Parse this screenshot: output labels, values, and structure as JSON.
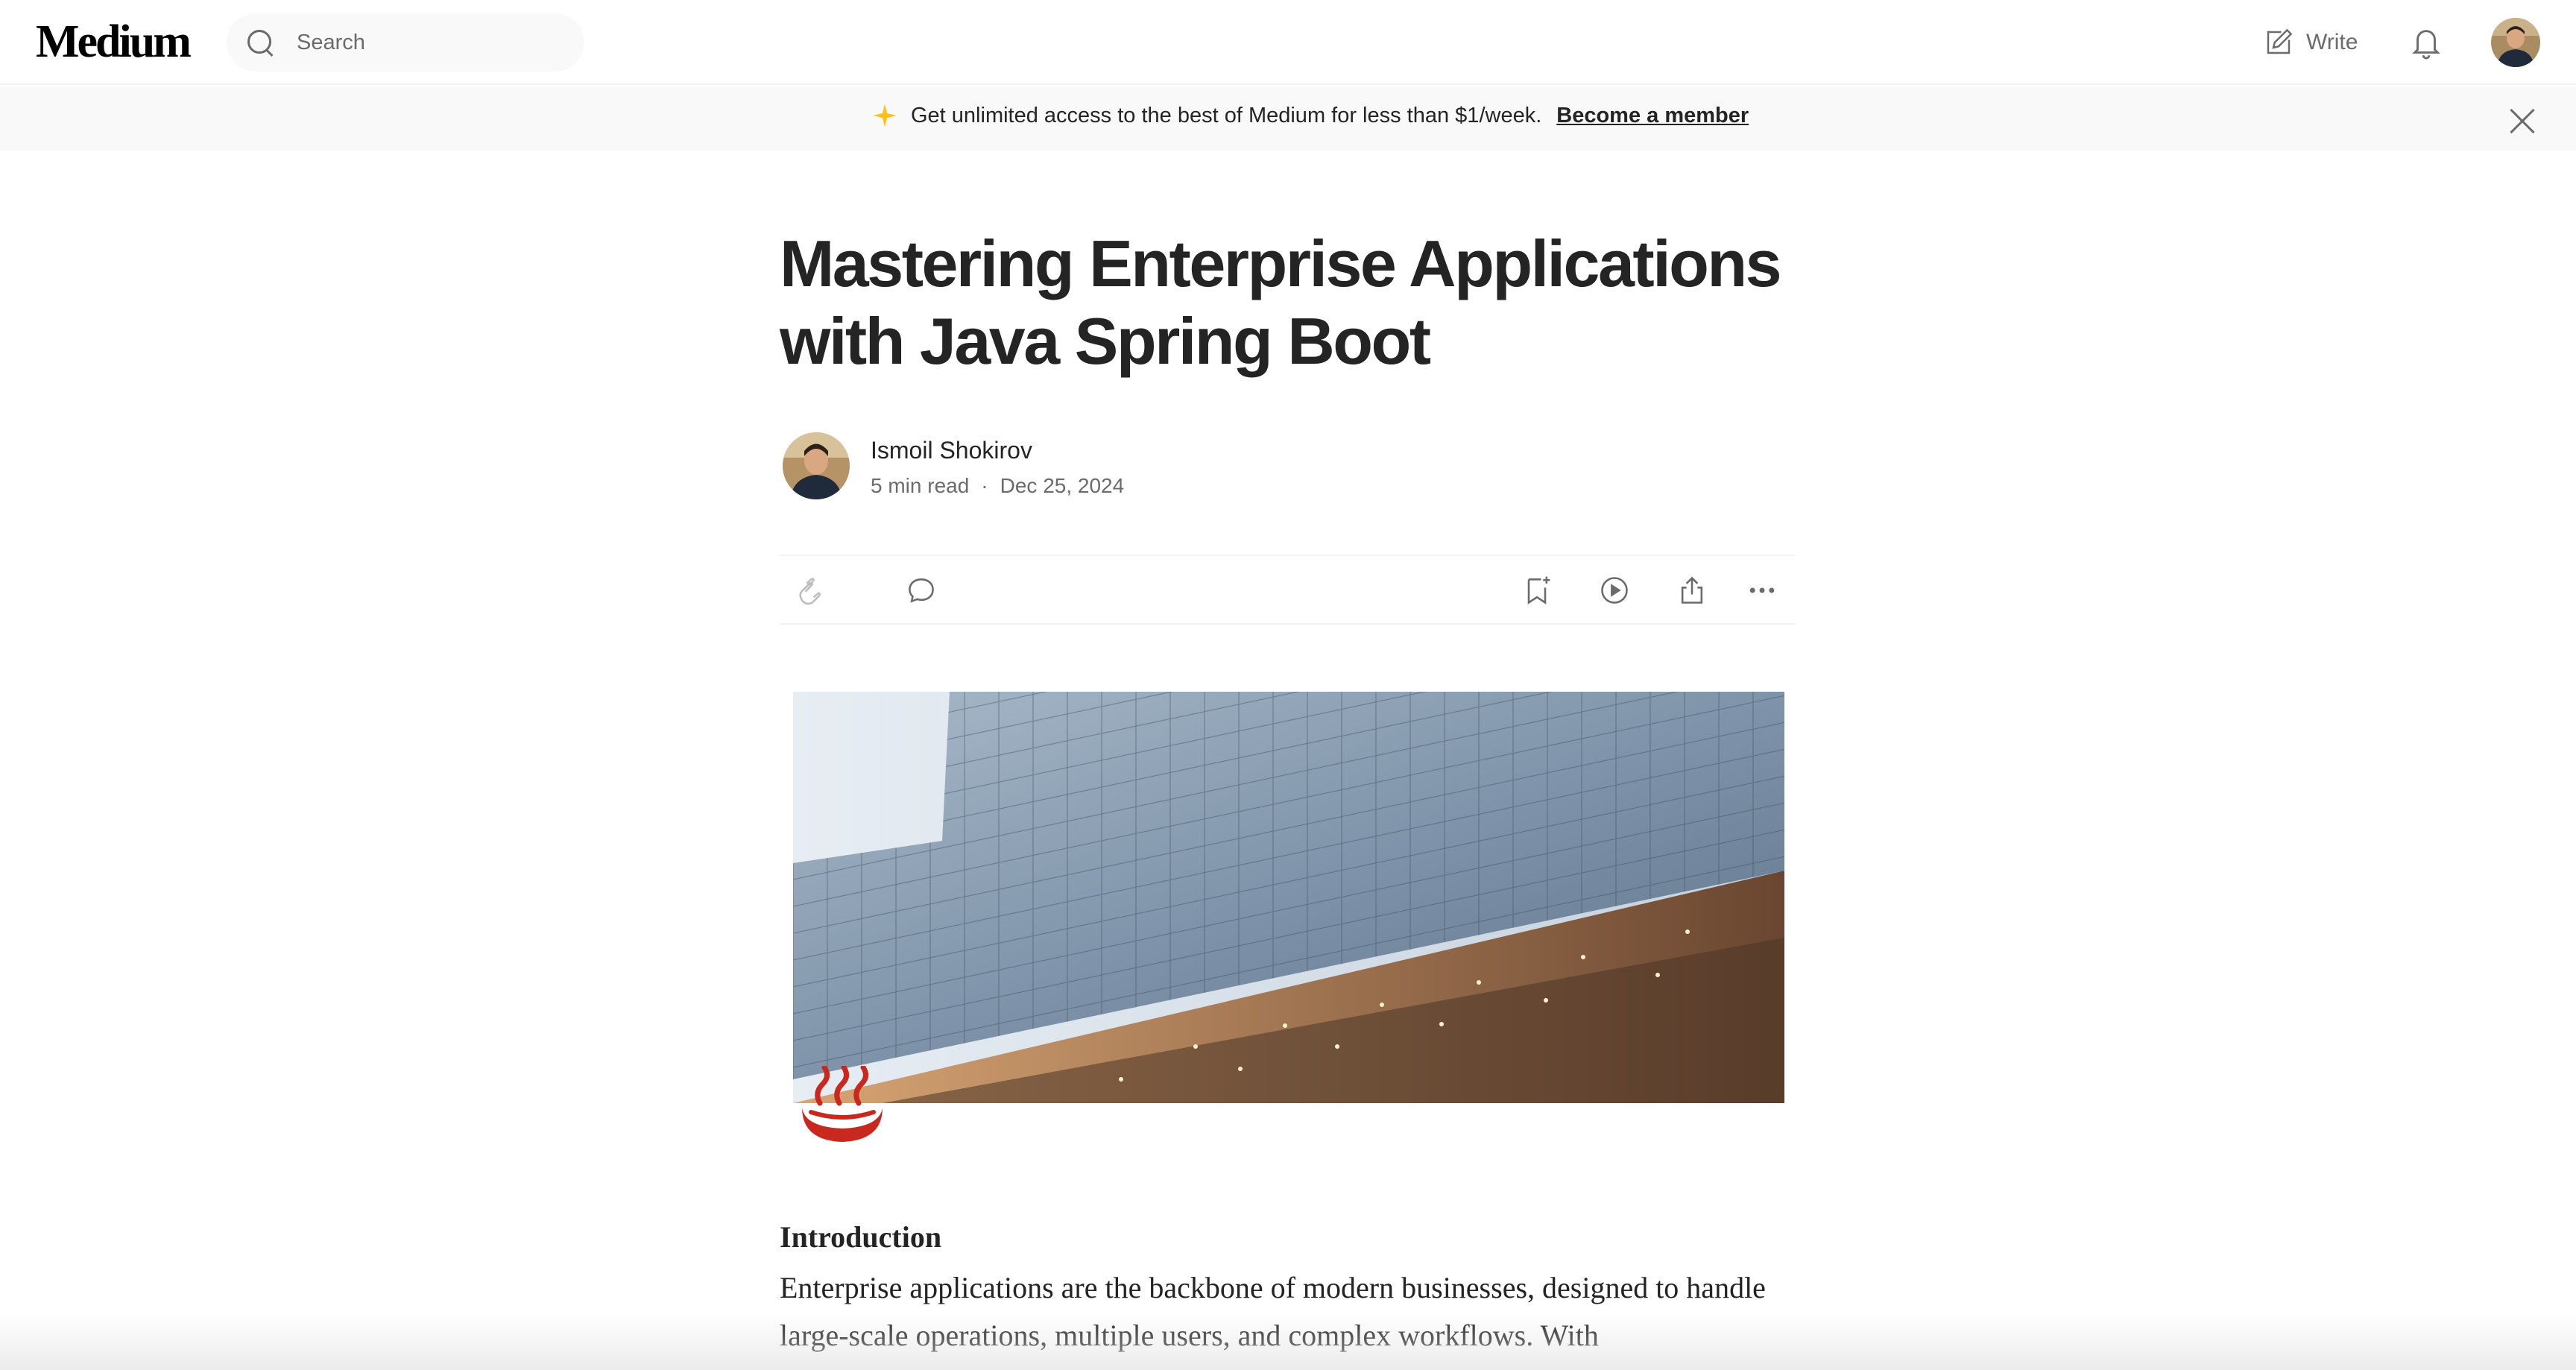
{
  "header": {
    "logo": "Medium",
    "search_placeholder": "Search",
    "write_label": "Write"
  },
  "banner": {
    "text": "Get unlimited access to the best of Medium for less than $1/week.",
    "link": "Become a member"
  },
  "article": {
    "title": "Mastering Enterprise Applications with Java Spring Boot",
    "author": "Ismoil Shokirov",
    "read_time": "5 min read",
    "separator": "·",
    "date": "Dec 25, 2024",
    "heading": "Introduction",
    "paragraph": "Enterprise applications are the backbone of modern businesses, designed to handle large-scale operations, multiple users, and complex workflows. With"
  },
  "icons": {
    "search": "search-icon",
    "write": "write-icon",
    "bell": "bell-icon",
    "sparkle": "sparkle-icon",
    "close": "close-icon",
    "clap": "clap-icon",
    "comment": "comment-icon",
    "bookmark": "bookmark-icon",
    "listen": "play-icon",
    "share": "share-icon",
    "more": "more-icon"
  },
  "colors": {
    "text": "#242424",
    "muted": "#6b6b6b",
    "banner_bg": "#f9f9f9",
    "sparkle": "#ffc017"
  }
}
